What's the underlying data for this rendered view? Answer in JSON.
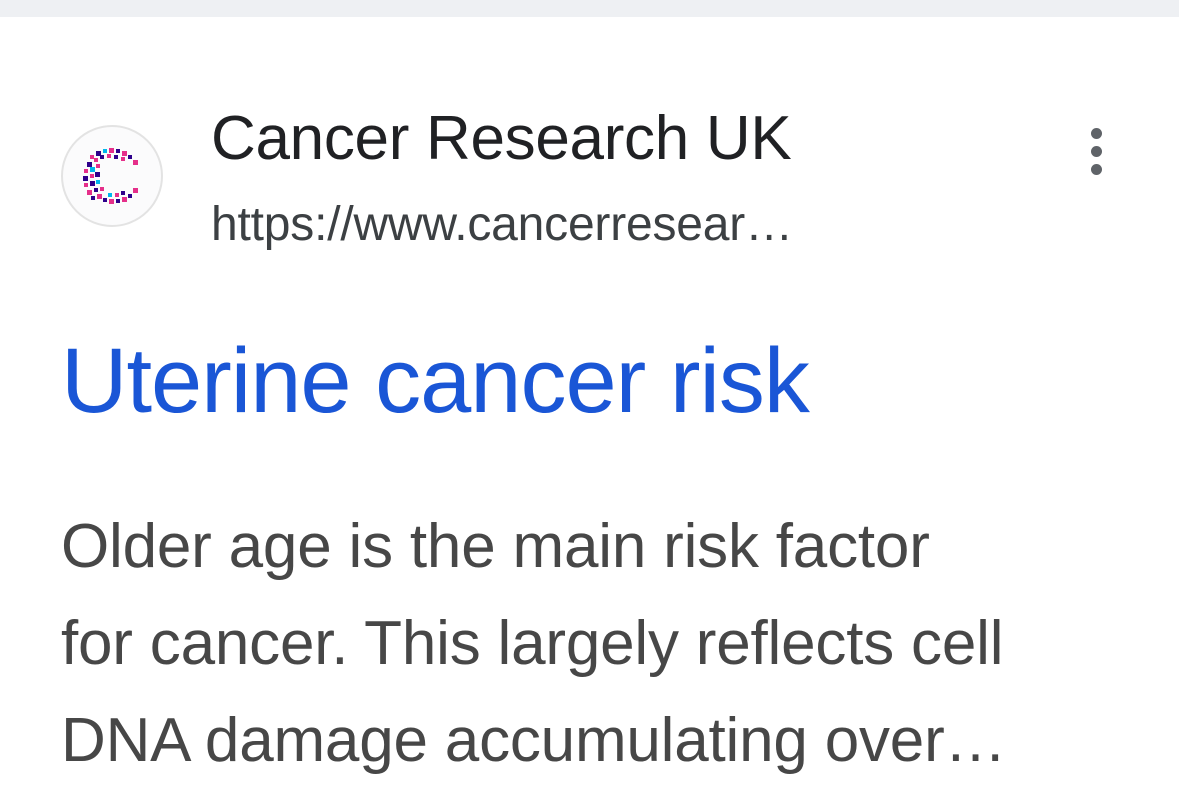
{
  "result": {
    "site_name": "Cancer Research UK",
    "url": "https://www.cancerresear…",
    "title": "Uterine cancer risk",
    "snippet_lines": [
      "Older age is the main risk factor",
      "for cancer. This largely reflects cell",
      "DNA damage accumulating over…"
    ],
    "favicon_icon": "cancer-research-uk-c-logo",
    "more_icon": "three-dot-vertical-icon"
  },
  "colors": {
    "title_link": "#1a56d6",
    "site_name": "#202124",
    "url": "#3c4043",
    "snippet": "#474747",
    "divider": "#eef0f3"
  }
}
